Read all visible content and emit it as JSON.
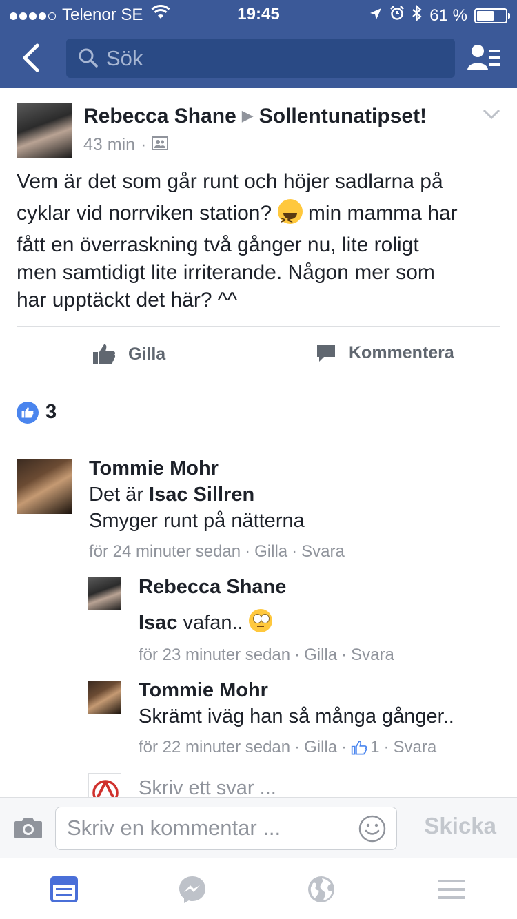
{
  "status_bar": {
    "carrier": "Telenor SE",
    "time": "19:45",
    "battery_label": "61 %",
    "battery_level": 0.61
  },
  "nav": {
    "search_placeholder": "Sök"
  },
  "post": {
    "author": "Rebecca Shane",
    "group": "Sollentunatipset!",
    "time_ago": "43 min",
    "meta_sep": "·",
    "text_line1": "Vem är det som går runt och höjer sadlarna på",
    "text_line2a": "cyklar vid norrviken station?",
    "text_line2b": "min mamma har",
    "text_line3": "fått en överraskning två gånger nu, lite roligt",
    "text_line4": "men samtidigt lite irriterande. Någon mer som",
    "text_line5": "har upptäckt det här? ^^",
    "like_label": "Gilla",
    "comment_label": "Kommentera",
    "like_count": "3"
  },
  "comments": [
    {
      "name": "Tommie Mohr",
      "line1_prefix": "Det är",
      "line1_bold": "Isac Sillren",
      "line2": "Smyger runt på nätterna",
      "time": "för 24 minuter sedan",
      "like": "Gilla",
      "reply": "Svara"
    }
  ],
  "replies": [
    {
      "name": "Rebecca Shane",
      "text_bold": "Isac",
      "text": "vafan..",
      "time": "för 23 minuter sedan",
      "like": "Gilla",
      "reply": "Svara"
    },
    {
      "name": "Tommie Mohr",
      "text": "Skrämt iväg han så många gånger..",
      "time": "för 22 minuter sedan",
      "like": "Gilla",
      "like_count": "1",
      "reply": "Svara"
    }
  ],
  "reply_input": {
    "placeholder": "Skriv ett svar ..."
  },
  "composer": {
    "placeholder": "Skriv en kommentar ...",
    "send_label": "Skicka"
  },
  "sep": "·",
  "colors": {
    "brand": "#3b5998",
    "like_badge": "#4a85ee"
  }
}
